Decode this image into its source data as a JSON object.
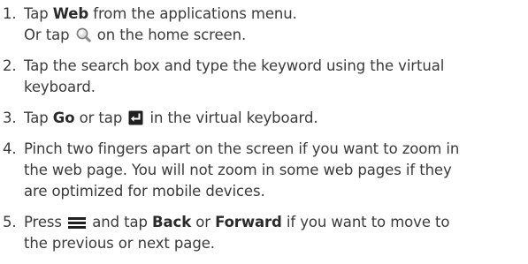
{
  "steps": [
    {
      "num": "1.",
      "l1_pre": "Tap ",
      "l1_bold": "Web",
      "l1_post": " from the applications menu.",
      "l2_pre": "Or tap ",
      "l2_icon": "magnifier-search-icon",
      "l2_post": " on the home screen."
    },
    {
      "num": "2.",
      "l1": "Tap the search box and type the keyword using the virtual",
      "l2": "keyboard."
    },
    {
      "num": "3.",
      "pre": "Tap ",
      "bold": "Go",
      "mid": " or tap ",
      "icon": "enter-key-icon",
      "post": " in the virtual keyboard."
    },
    {
      "num": "4.",
      "l1": "Pinch two fingers apart on the screen if you want to zoom in",
      "l2": "the web page. You will not zoom in some web pages if they",
      "l3": "are optimized for mobile devices."
    },
    {
      "num": "5.",
      "pre": "Press ",
      "icon": "menu-key-icon",
      "mid1": " and tap ",
      "bold1": "Back",
      "mid2": " or ",
      "bold2": "Forward",
      "post": " if you want to move to",
      "l2": "the previous or next page."
    }
  ]
}
